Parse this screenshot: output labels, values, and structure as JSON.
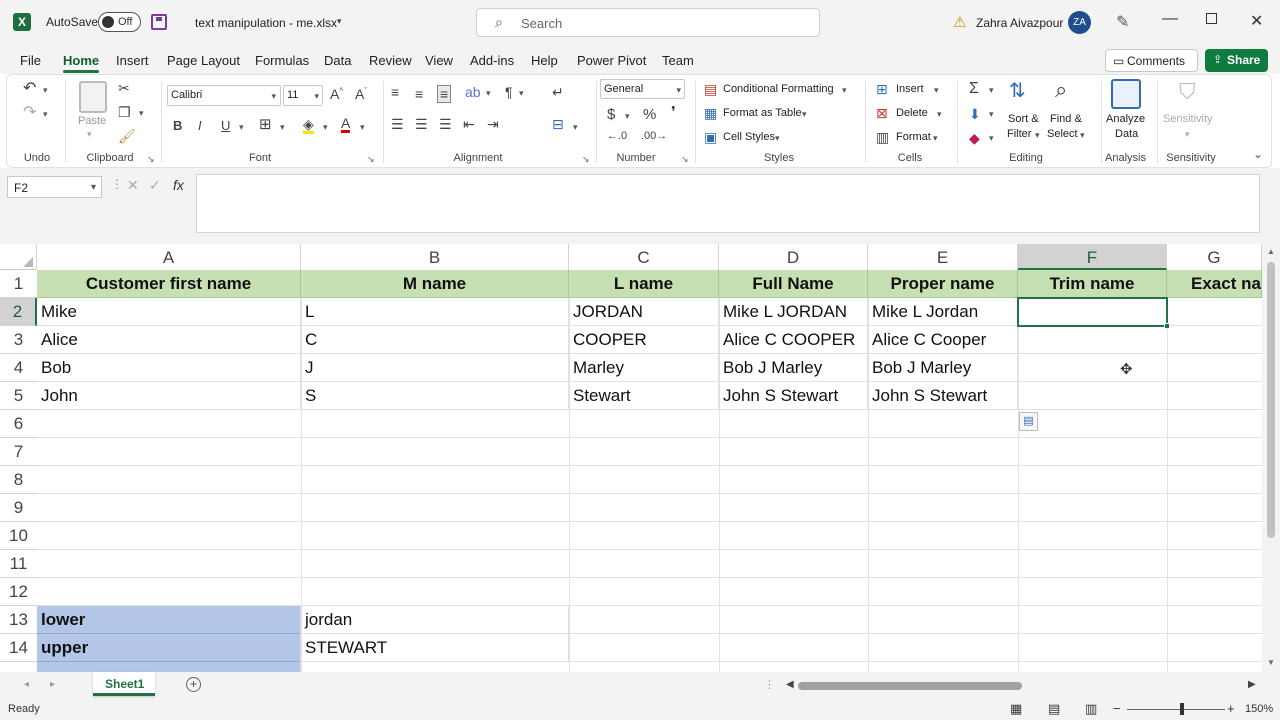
{
  "title_bar": {
    "autosave_label": "AutoSave",
    "autosave_state": "Off",
    "file_name": "text manipulation - me.xlsx",
    "search_placeholder": "Search",
    "user_name": "Zahra Aivazpour",
    "user_initials": "ZA"
  },
  "menu": {
    "items": [
      "File",
      "Home",
      "Insert",
      "Page Layout",
      "Formulas",
      "Data",
      "Review",
      "View",
      "Add-ins",
      "Help",
      "Power Pivot",
      "Team"
    ],
    "active": "Home",
    "comments_label": "Comments",
    "share_label": "Share"
  },
  "ribbon": {
    "groups": [
      "Undo",
      "Clipboard",
      "Font",
      "Alignment",
      "Number",
      "Styles",
      "Cells",
      "Editing",
      "Analysis",
      "Sensitivity"
    ],
    "paste_label": "Paste",
    "font_name": "Calibri",
    "font_size": "11",
    "number_format": "General",
    "conditional_formatting": "Conditional Formatting",
    "format_as_table": "Format as Table",
    "cell_styles": "Cell Styles",
    "insert": "Insert",
    "delete": "Delete",
    "format": "Format",
    "sort_filter": [
      "Sort &",
      "Filter"
    ],
    "find_select": [
      "Find &",
      "Select"
    ],
    "analyze_data": [
      "Analyze",
      "Data"
    ],
    "sensitivity": "Sensitivity"
  },
  "formula_bar": {
    "name_box": "F2",
    "fx": "fx",
    "value": ""
  },
  "sheet": {
    "columns": [
      "A",
      "B",
      "C",
      "D",
      "E",
      "F",
      "G"
    ],
    "rows": [
      "1",
      "2",
      "3",
      "4",
      "5",
      "6",
      "7",
      "8",
      "9",
      "10",
      "11",
      "12",
      "13",
      "14"
    ],
    "header_row": [
      "Customer first name",
      "M name",
      "L name",
      "Full Name",
      "Proper name",
      "Trim name",
      "Exact na"
    ],
    "data": [
      [
        "Mike",
        "L",
        "JORDAN",
        "Mike L JORDAN",
        "Mike L Jordan"
      ],
      [
        "Alice",
        "C",
        "COOPER",
        "Alice C COOPER",
        "Alice C Cooper"
      ],
      [
        "Bob",
        "J",
        "Marley",
        "Bob J Marley",
        "Bob J Marley"
      ],
      [
        "John",
        "S",
        "Stewart",
        "John S Stewart",
        "John S Stewart"
      ]
    ],
    "row13": [
      "lower",
      "jordan"
    ],
    "row14": [
      "upper",
      "STEWART"
    ],
    "selected_cell": "F2"
  },
  "tabs": {
    "sheet1": "Sheet1"
  },
  "status": {
    "ready": "Ready",
    "zoom": "150%"
  },
  "colors": {
    "excel_green": "#217346",
    "header_green": "#c6e0b4",
    "label_blue": "#b4c6e7",
    "share_green": "#0f7b3f"
  }
}
